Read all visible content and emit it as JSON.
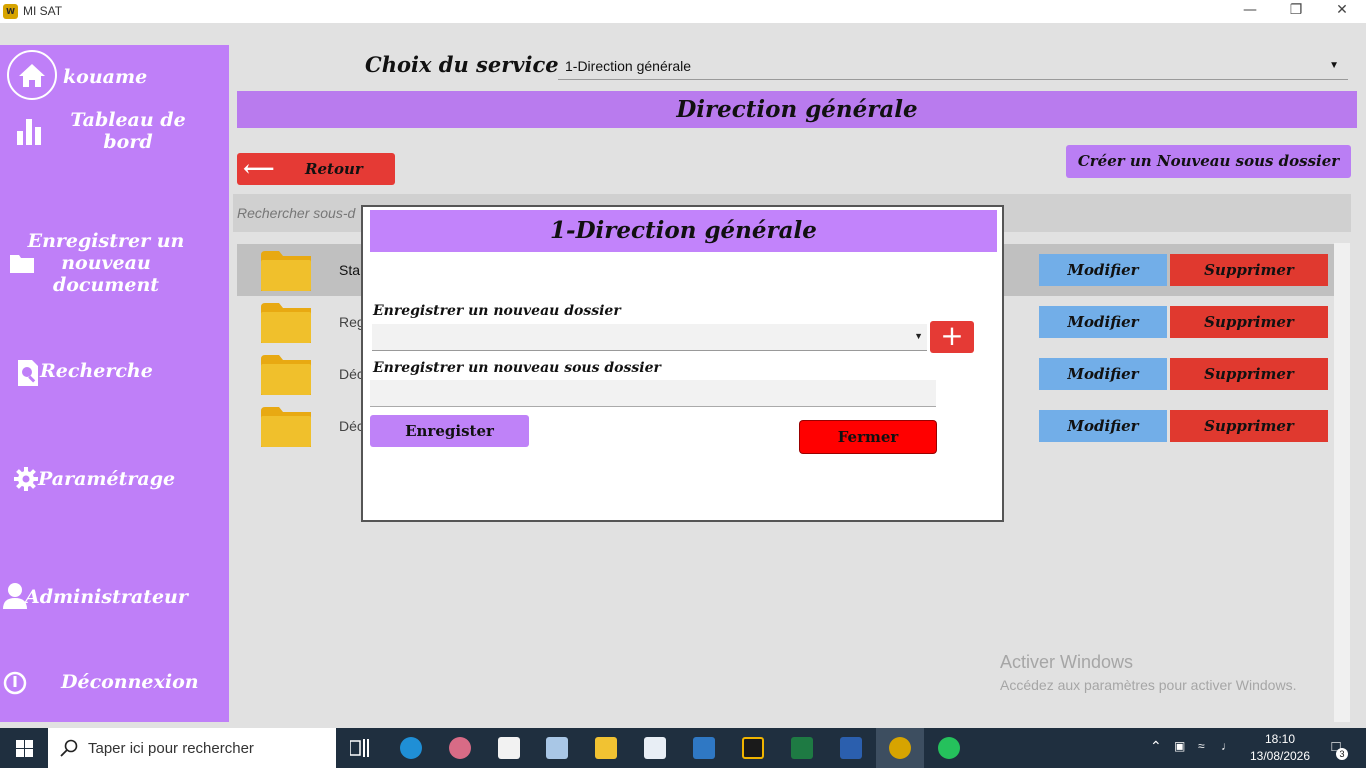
{
  "window": {
    "title": "MI SAT",
    "icon_text": "W"
  },
  "sidebar": {
    "user": "kouame",
    "items": [
      {
        "label": "Tableau de bord",
        "icon": "bar-chart-icon"
      },
      {
        "label": "Enregistrer un nouveau document",
        "icon": "folder-icon"
      },
      {
        "label": "Recherche",
        "icon": "search-doc-icon"
      },
      {
        "label": "Paramétrage",
        "icon": "gear-icon"
      },
      {
        "label": "Administrateur",
        "icon": "user-icon"
      },
      {
        "label": "Déconnexion",
        "icon": "power-icon"
      }
    ],
    "labels": {
      "tableau": "Tableau de bord",
      "enregistrer": "Enregistrer un nouveau document",
      "recherche": "Recherche",
      "parametrage": "Paramétrage",
      "administrateur": "Administrateur",
      "deconnexion": "Déconnexion"
    },
    "colors": {
      "background": "#bf7ff8"
    }
  },
  "main": {
    "service_label": "Choix du service",
    "service_selected": "1-Direction générale",
    "header_title": "Direction générale",
    "back_button": "Retour",
    "create_button": "Créer un Nouveau sous dossier",
    "search_placeholder": "Rechercher sous-d",
    "rows": [
      {
        "name": "Sta",
        "modify": "Modifier",
        "delete": "Supprimer"
      },
      {
        "name": "Reg",
        "modify": "Modifier",
        "delete": "Supprimer"
      },
      {
        "name": "Déc",
        "modify": "Modifier",
        "delete": "Supprimer"
      },
      {
        "name": "Déc",
        "modify": "Modifier",
        "delete": "Supprimer"
      }
    ]
  },
  "modal": {
    "title": "1-Direction générale",
    "new_folder_label": "Enregistrer un nouveau dossier",
    "new_subfolder_label": "Enregistrer un nouveau sous dossier",
    "new_folder_value": "",
    "new_subfolder_value": "",
    "save_button": "Enregister",
    "close_button": "Fermer",
    "add_button": "+"
  },
  "watermark": {
    "line1": "Activer Windows",
    "line2": "Accédez aux paramètres pour activer Windows."
  },
  "taskbar": {
    "search_placeholder": "Taper ici pour rechercher",
    "time": "18:10",
    "date": "13/08/2026",
    "notification_count": "3",
    "apps": [
      "task-view",
      "edge",
      "paint",
      "store",
      "notepad",
      "explorer",
      "photos",
      "outlook",
      "sketch",
      "excel",
      "word",
      "windev",
      "whatsapp"
    ]
  },
  "colors": {
    "accent_purple": "#bf7ff8",
    "danger_red": "#e53a35",
    "modify_blue": "#72aee8",
    "close_red": "#ff0000"
  }
}
